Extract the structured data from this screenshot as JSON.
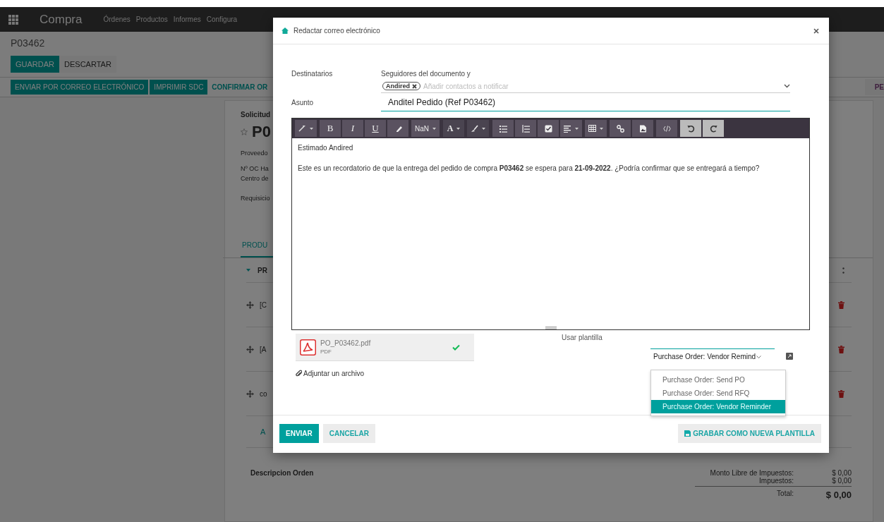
{
  "navbar": {
    "app": "Compra",
    "menu": [
      "Órdenes",
      "Productos",
      "Informes",
      "Configura"
    ]
  },
  "breadcrumb": "P03462",
  "edit_buttons": [
    {
      "label": "GUARDAR",
      "kind": "primary"
    },
    {
      "label": "DESCARTAR",
      "kind": "plain"
    }
  ],
  "header_buttons": [
    {
      "label": "ENVIAR POR CORREO ELECTRÓNICO",
      "kind": "primary"
    },
    {
      "label": "IMPRIMIR SDC",
      "kind": "primary"
    },
    {
      "label": "CONFIRMAR OR",
      "kind": "link"
    }
  ],
  "status_stage": "PE",
  "sheet": {
    "title_label": "Solicitud",
    "title": "P0",
    "fields": [
      "Proveedo",
      "Nº OC Ha",
      "Centro de",
      "Requisicio"
    ],
    "tab": "PRODU",
    "column": "PR",
    "rows": [
      "[C",
      "[A",
      "co"
    ],
    "add_line": "A",
    "notes_label": "Descripcion Orden",
    "totals": [
      {
        "label": "Monto Libre de Impuestos:",
        "value": "$ 0,00",
        "kind": "plain"
      },
      {
        "label": "Impuestos:",
        "value": "$ 0,00",
        "kind": "plain"
      },
      {
        "label": "Total:",
        "value": "$ 0,00",
        "kind": "total"
      }
    ]
  },
  "dialog": {
    "title": "Redactar correo electrónico",
    "recipients": {
      "label": "Destinatarios",
      "followers": "Seguidores del documento y",
      "tags": [
        "Andired"
      ],
      "placeholder": "Añadir contactos a notificar"
    },
    "subject": {
      "label": "Asunto",
      "value": "Anditel Pedido (Ref P03462)"
    },
    "toolbar": [
      {
        "buttons": [
          {
            "kind": "magic",
            "dropdown": true
          }
        ]
      },
      {
        "buttons": [
          {
            "kind": "bold",
            "label": "B"
          },
          {
            "kind": "italic",
            "label": "I"
          },
          {
            "kind": "underline",
            "label": "U"
          },
          {
            "kind": "eraser"
          }
        ]
      },
      {
        "buttons": [
          {
            "kind": "size",
            "label": "NaN",
            "dropdown": true
          }
        ]
      },
      {
        "buttons": [
          {
            "kind": "color",
            "label": "A",
            "dropdown": true
          },
          {
            "kind": "brush",
            "dropdown": true
          }
        ]
      },
      {
        "buttons": [
          {
            "kind": "bullets"
          },
          {
            "kind": "numbers"
          },
          {
            "kind": "checklist"
          },
          {
            "kind": "align",
            "dropdown": true
          }
        ]
      },
      {
        "buttons": [
          {
            "kind": "table",
            "dropdown": true
          }
        ]
      },
      {
        "buttons": [
          {
            "kind": "link"
          },
          {
            "kind": "image"
          }
        ]
      },
      {
        "buttons": [
          {
            "kind": "code"
          }
        ]
      },
      {
        "buttons": [
          {
            "kind": "undo"
          },
          {
            "kind": "redo"
          }
        ]
      }
    ],
    "body": [
      "Estimado Andired",
      "Este es un recordatorio de que la entrega del pedido de compra **P03462** se espera para **21-09-2022**. ¿Podría confirmar que se entregará a tiempo?"
    ],
    "attachments": [
      {
        "name": "PO_P03462.pdf",
        "type": "PDF",
        "uploaded": true
      }
    ],
    "attach_link": "Adjuntar un archivo",
    "template": {
      "label": "Usar plantilla",
      "value": "Purchase Order: Vendor Remind",
      "options": [
        {
          "label": "Purchase Order: Send PO",
          "selected": false
        },
        {
          "label": "Purchase Order: Send RFQ",
          "selected": false
        },
        {
          "label": "Purchase Order: Vendor Reminder",
          "selected": true
        }
      ]
    },
    "buttons": [
      {
        "label": "ENVIAR",
        "kind": "primary"
      },
      {
        "label": "CANCELAR",
        "kind": "secondary"
      }
    ],
    "save_template": "GRABAR COMO NUEVA PLANTILLA"
  }
}
